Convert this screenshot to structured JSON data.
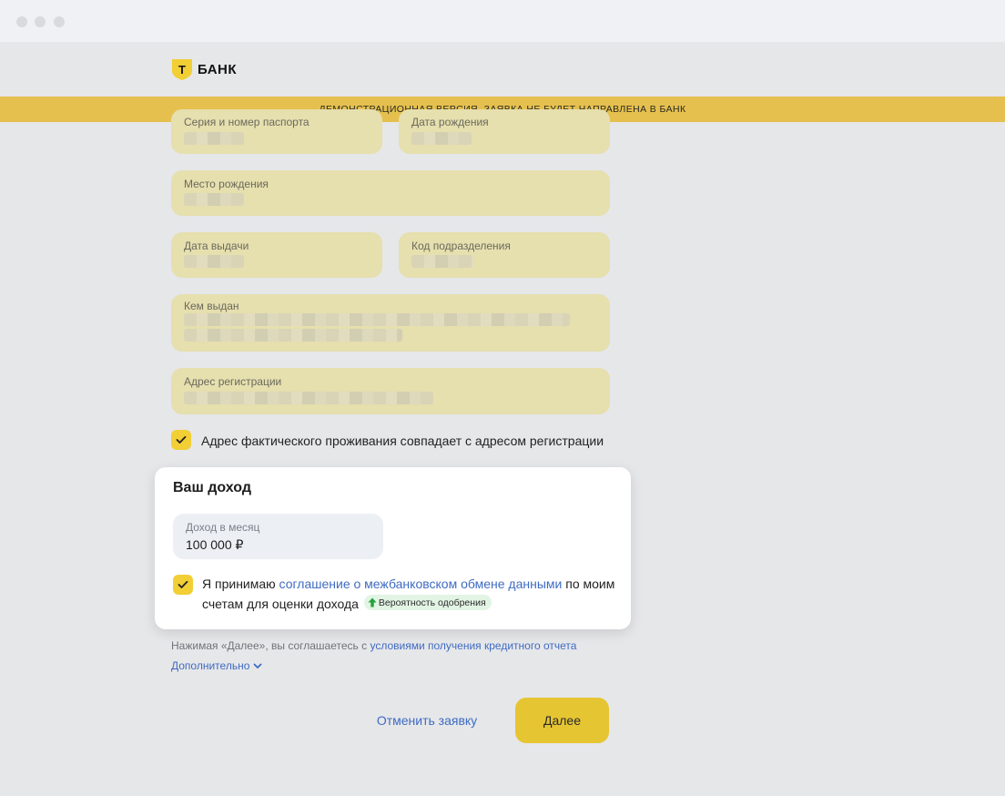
{
  "brand": {
    "name": "БАНК",
    "logo_letter": "Т",
    "accent": "#f1cf35"
  },
  "banner": {
    "text": "ДЕМОНСТРАЦИОННАЯ ВЕРСИЯ. ЗАЯВКА НЕ БУДЕТ НАПРАВЛЕНА В БАНК"
  },
  "passport": {
    "series_label": "Серия и номер паспорта",
    "birth_date_label": "Дата рождения",
    "birth_place_label": "Место рождения",
    "issue_date_label": "Дата выдачи",
    "division_code_label": "Код подразделения",
    "issued_by_label": "Кем выдан",
    "registration_label": "Адрес регистрации",
    "same_address_checked": true,
    "same_address_label": "Адрес фактического проживания совпадает с адресом регистрации"
  },
  "income": {
    "title": "Ваш доход",
    "field_label": "Доход в месяц",
    "field_value": "100 000 ₽",
    "consent_checked": true,
    "consent_prefix": "Я принимаю ",
    "consent_link": "соглашение о межбанковском обмене данными",
    "consent_suffix": " по моим счетам для оценки дохода",
    "badge_label": "Вероятность одобрения"
  },
  "footer": {
    "note_prefix": "Нажимая «Далее», вы соглашаетесь с ",
    "note_link": "условиями получения кредитного отчета",
    "more_label": "Дополнительно"
  },
  "actions": {
    "cancel_label": "Отменить заявку",
    "next_label": "Далее"
  }
}
